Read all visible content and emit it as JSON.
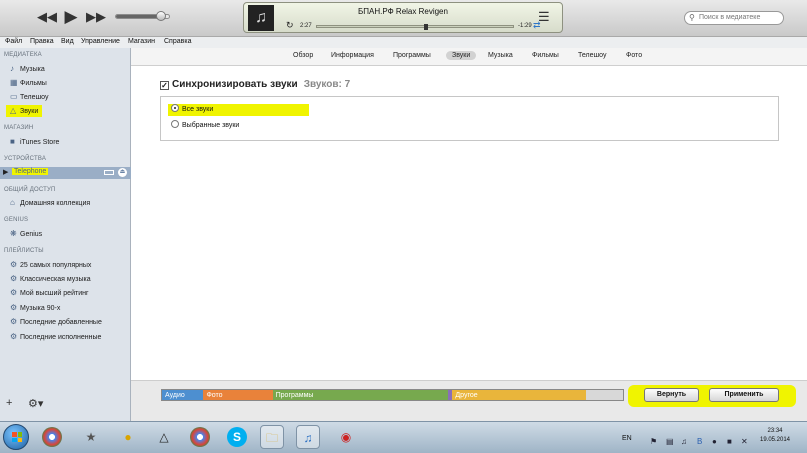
{
  "player": {
    "prev_icon": "rewind-icon",
    "play_icon": "play-icon",
    "next_icon": "fast-forward-icon",
    "volume_level": 0.85,
    "now_playing": "БПАН.РФ  Relax Revigen",
    "elapsed": "2:27",
    "remaining": "-1:29",
    "progress": 0.55
  },
  "search": {
    "placeholder": "Поиск в медиатеке"
  },
  "menu": [
    "Файл",
    "Правка",
    "Вид",
    "Управление",
    "Магазин",
    "Справка"
  ],
  "sidebar": {
    "library_header": "МЕДИАТЕКА",
    "library": [
      "Музыка",
      "Фильмы",
      "Телешоу",
      "Звуки"
    ],
    "store_header": "МАГАЗИН",
    "store": [
      "iTunes Store"
    ],
    "devices_header": "УСТРОЙСТВА",
    "device": "Telephone",
    "shared_header": "ОБЩИЙ ДОСТУП",
    "shared": [
      "Домашняя коллекция"
    ],
    "genius_header": "GENIUS",
    "genius": [
      "Genius"
    ],
    "playlists_header": "ПЛЕЙЛИСТЫ",
    "playlists": [
      "25 самых популярных",
      "Классическая музыка",
      "Мой высший рейтинг",
      "Музыка 90-х",
      "Последние добавленные",
      "Последние исполненные"
    ]
  },
  "tabs": [
    "Обзор",
    "Информация",
    "Программы",
    "Звуки",
    "Музыка",
    "Фильмы",
    "Телешоу",
    "Фото"
  ],
  "active_tab": "Звуки",
  "sync": {
    "label": "Синхронизировать звуки",
    "count": "Звуков: 7",
    "checked": true,
    "options": [
      "Все звуки",
      "Выбранные звуки"
    ],
    "selected": "Все звуки"
  },
  "capacity": {
    "segments": [
      {
        "label": "Аудио",
        "color": "#4d8fd0",
        "fraction": 0.09
      },
      {
        "label": "Фото",
        "color": "#e9823a",
        "fraction": 0.15
      },
      {
        "label": "Программы",
        "color": "#77a94e",
        "fraction": 0.38
      },
      {
        "label": "",
        "color": "#8a6fb8",
        "fraction": 0.01
      },
      {
        "label": "Другое",
        "color": "#e9b53b",
        "fraction": 0.29
      },
      {
        "label": "",
        "color": "#d8d8d8",
        "fraction": 0.08
      }
    ],
    "revert": "Вернуть",
    "apply": "Применить"
  },
  "taskbar": {
    "lang": "EN",
    "time": "23:34",
    "date": "19.05.2014"
  },
  "colors": {
    "highlight": "#f0f400",
    "sidebar_bg": "#dde3ea",
    "selection": "#9aaec6"
  }
}
